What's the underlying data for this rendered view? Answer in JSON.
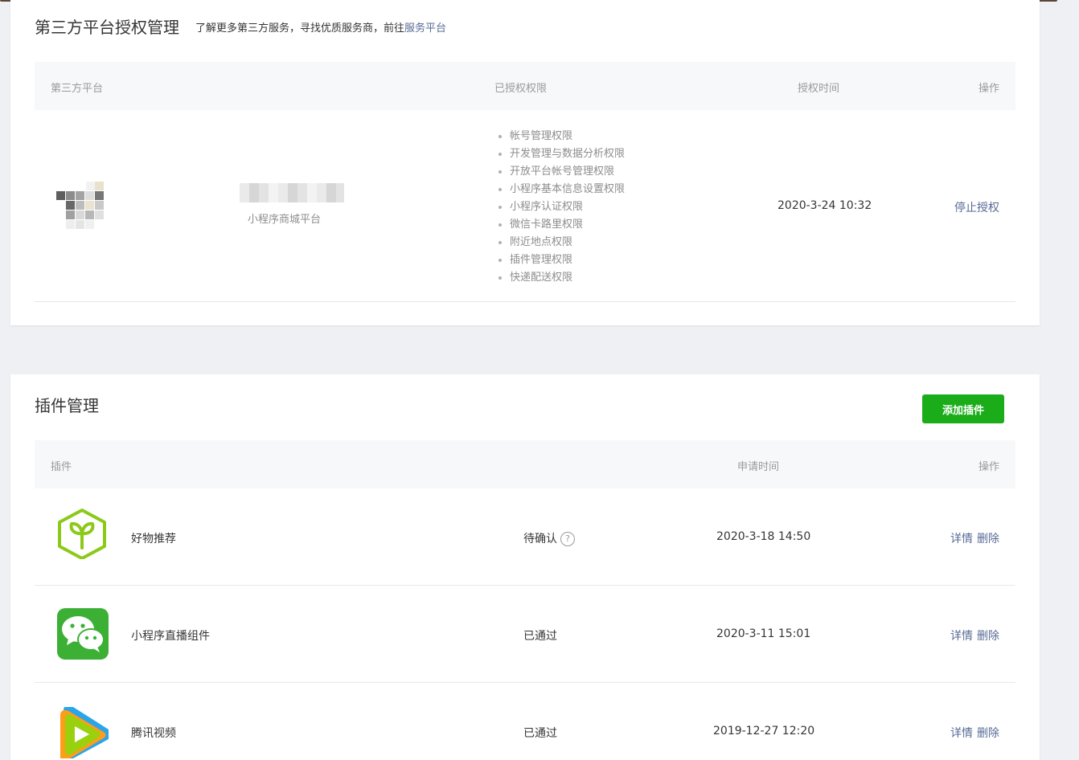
{
  "auth": {
    "title": "第三方平台授权管理",
    "subtitle_text": "了解更多第三方服务，寻找优质服务商，前往",
    "subtitle_link": "服务平台",
    "columns": [
      "第三方平台",
      "已授权权限",
      "授权时间",
      "操作"
    ],
    "row": {
      "platform_type": "小程序商城平台",
      "permissions": [
        "帐号管理权限",
        "开发管理与数据分析权限",
        "开放平台帐号管理权限",
        "小程序基本信息设置权限",
        "小程序认证权限",
        "微信卡路里权限",
        "附近地点权限",
        "插件管理权限",
        "快递配送权限"
      ],
      "time": "2020-3-24 10:32",
      "action": "停止授权"
    }
  },
  "plugins": {
    "title": "插件管理",
    "add_button": "添加插件",
    "columns": [
      "插件",
      "申请时间",
      "操作"
    ],
    "rows": [
      {
        "name": "好物推荐",
        "icon": "sprout-box-icon",
        "status": "待确认",
        "time": "2020-3-18 14:50",
        "detail": "详情",
        "delete": "删除"
      },
      {
        "name": "小程序直播组件",
        "icon": "wechat-icon",
        "status": "已通过",
        "time": "2020-3-11 15:01",
        "detail": "详情",
        "delete": "删除"
      },
      {
        "name": "腾讯视频",
        "icon": "tencent-video-icon",
        "status": "已通过",
        "time": "2019-12-27 12:20",
        "detail": "详情",
        "delete": "删除"
      }
    ]
  },
  "colors": {
    "accent_green": "#1aad19",
    "link_blue": "#576b95"
  }
}
